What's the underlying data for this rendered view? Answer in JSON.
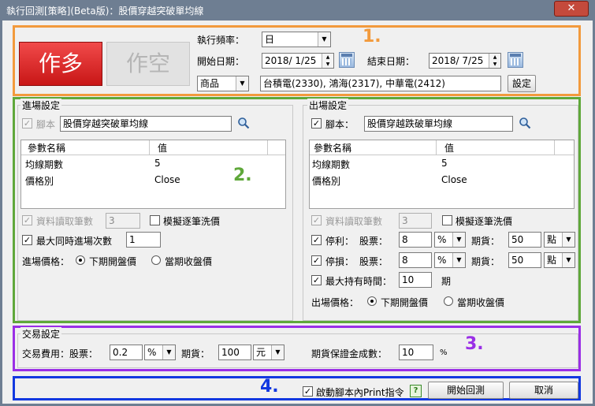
{
  "window": {
    "title": "執行回測[策略](Beta版)：股價穿越突破單均線",
    "close": "✕"
  },
  "direction": {
    "long": "作多",
    "short": "作空"
  },
  "top": {
    "freq_label": "執行頻率：",
    "freq_value": "日",
    "start_label": "開始日期：",
    "start_value": "2018/ 1/25",
    "end_label": "結束日期：",
    "end_value": "2018/ 7/25",
    "type_value": "商品",
    "products": "台積電(2330), 鴻海(2317), 中華電(2412)",
    "settings_btn": "設定"
  },
  "annotations": {
    "a1": "1.",
    "a2": "2.",
    "a3": "3.",
    "a4": "4."
  },
  "entry": {
    "title": "進場設定",
    "script_label": "腳本",
    "script_value": "股價穿越突破單均線",
    "col_name": "參數名稱",
    "col_value": "值",
    "rows": [
      {
        "name": "均線期數",
        "value": "5"
      },
      {
        "name": "價格別",
        "value": "Close"
      }
    ],
    "data_count_label": "資料讀取筆數",
    "data_count_value": "3",
    "simulate_label": "模擬逐筆洗價",
    "max_entries_label": "最大同時進場次數",
    "max_entries_value": "1",
    "price_label": "進場價格：",
    "opt_next_open": "下期開盤價",
    "opt_close": "當期收盤價"
  },
  "exit": {
    "title": "出場設定",
    "script_label": "腳本：",
    "script_value": "股價穿越跌破單均線",
    "col_name": "參數名稱",
    "col_value": "值",
    "rows": [
      {
        "name": "均線期數",
        "value": "5"
      },
      {
        "name": "價格別",
        "value": "Close"
      }
    ],
    "data_count_label": "資料讀取筆數",
    "data_count_value": "3",
    "simulate_label": "模擬逐筆洗價",
    "tp_label": "停利：",
    "sl_label": "停損：",
    "stock_label": "股票：",
    "futures_label": "期貨：",
    "tp_stock_value": "8",
    "tp_stock_unit": "%",
    "tp_fut_value": "50",
    "tp_fut_unit": "點",
    "sl_stock_value": "8",
    "sl_stock_unit": "%",
    "sl_fut_value": "50",
    "sl_fut_unit": "點",
    "max_hold_label": "最大持有時間：",
    "max_hold_value": "10",
    "max_hold_unit": "期",
    "price_label": "出場價格：",
    "opt_next_open": "下期開盤價",
    "opt_close": "當期收盤價"
  },
  "trade": {
    "title": "交易設定",
    "fee_label": "交易費用：股票：",
    "fee_stock_value": "0.2",
    "fee_stock_unit": "%",
    "fee_fut_label": "期貨：",
    "fee_fut_value": "100",
    "fee_fut_unit": "元",
    "margin_label": "期貨保證金成數：",
    "margin_value": "10",
    "margin_unit": "%"
  },
  "footer": {
    "print_label": "啟動腳本內Print指令",
    "help": "?",
    "start_btn": "開始回測",
    "cancel_btn": "取消"
  },
  "colors": {
    "orange": "#f29a3c",
    "green": "#5fa83a",
    "purple": "#9a2fe6",
    "blue": "#1238e0",
    "long_red": "#d92323"
  }
}
